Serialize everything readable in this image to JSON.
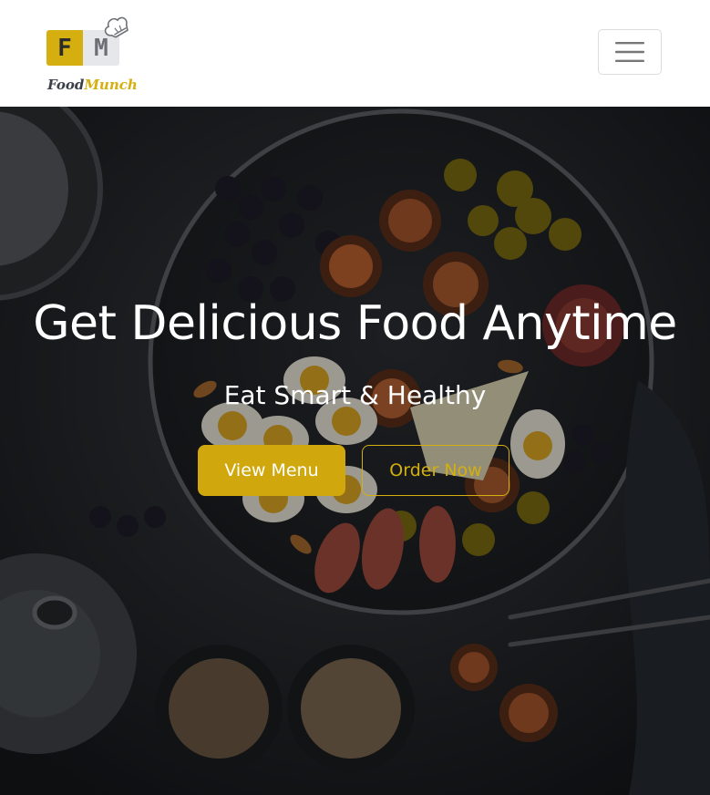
{
  "brand": {
    "logo_letters": [
      "F",
      "M"
    ],
    "name_part1": "Food",
    "name_part2": "Munch",
    "accent_color": "#d4af0f"
  },
  "navbar": {
    "toggler_icon": "hamburger-menu-icon"
  },
  "hero": {
    "title": "Get Delicious Food Anytime",
    "subtitle": "Eat Smart & Healthy",
    "view_menu_label": "View Menu",
    "order_now_label": "Order Now",
    "background": "dark table with plate of figs, grapes, eggs, olives, cheese and coffee cups"
  }
}
